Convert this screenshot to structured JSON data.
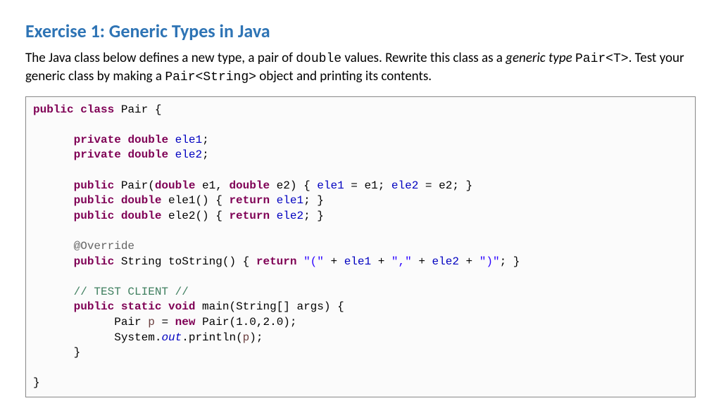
{
  "title": "Exercise 1: Generic Types in Java",
  "description": {
    "part1": "The Java class below defines a new type, a pair of ",
    "code1": "double",
    "part2": " values. Rewrite this class as a ",
    "italic1": "generic type",
    "part3": " ",
    "code2": "Pair<T>",
    "part4": ". Test your generic class by making a ",
    "code3": "Pair<String>",
    "part5": " object and printing its contents."
  },
  "code": {
    "tokens": [
      [
        [
          "kw",
          "public"
        ],
        [
          "plain",
          " "
        ],
        [
          "kw",
          "class"
        ],
        [
          "plain",
          " Pair {"
        ]
      ],
      [],
      [
        [
          "plain",
          "      "
        ],
        [
          "kw",
          "private"
        ],
        [
          "plain",
          " "
        ],
        [
          "kw",
          "double"
        ],
        [
          "plain",
          " "
        ],
        [
          "field",
          "ele1"
        ],
        [
          "plain",
          ";"
        ]
      ],
      [
        [
          "plain",
          "      "
        ],
        [
          "kw",
          "private"
        ],
        [
          "plain",
          " "
        ],
        [
          "kw",
          "double"
        ],
        [
          "plain",
          " "
        ],
        [
          "field",
          "ele2"
        ],
        [
          "plain",
          ";"
        ]
      ],
      [],
      [
        [
          "plain",
          "      "
        ],
        [
          "kw",
          "public"
        ],
        [
          "plain",
          " Pair("
        ],
        [
          "kw",
          "double"
        ],
        [
          "plain",
          " e1, "
        ],
        [
          "kw",
          "double"
        ],
        [
          "plain",
          " e2) { "
        ],
        [
          "field",
          "ele1"
        ],
        [
          "plain",
          " = e1; "
        ],
        [
          "field",
          "ele2"
        ],
        [
          "plain",
          " = e2; }"
        ]
      ],
      [
        [
          "plain",
          "      "
        ],
        [
          "kw",
          "public"
        ],
        [
          "plain",
          " "
        ],
        [
          "kw",
          "double"
        ],
        [
          "plain",
          " ele1() { "
        ],
        [
          "kw",
          "return"
        ],
        [
          "plain",
          " "
        ],
        [
          "field",
          "ele1"
        ],
        [
          "plain",
          "; }"
        ]
      ],
      [
        [
          "plain",
          "      "
        ],
        [
          "kw",
          "public"
        ],
        [
          "plain",
          " "
        ],
        [
          "kw",
          "double"
        ],
        [
          "plain",
          " ele2() { "
        ],
        [
          "kw",
          "return"
        ],
        [
          "plain",
          " "
        ],
        [
          "field",
          "ele2"
        ],
        [
          "plain",
          "; }"
        ]
      ],
      [],
      [
        [
          "plain",
          "      "
        ],
        [
          "annot",
          "@Override"
        ]
      ],
      [
        [
          "plain",
          "      "
        ],
        [
          "kw",
          "public"
        ],
        [
          "plain",
          " String toString() { "
        ],
        [
          "kw",
          "return"
        ],
        [
          "plain",
          " "
        ],
        [
          "str",
          "\"(\""
        ],
        [
          "plain",
          " + "
        ],
        [
          "field",
          "ele1"
        ],
        [
          "plain",
          " + "
        ],
        [
          "str",
          "\",\""
        ],
        [
          "plain",
          " + "
        ],
        [
          "field",
          "ele2"
        ],
        [
          "plain",
          " + "
        ],
        [
          "str",
          "\")\""
        ],
        [
          "plain",
          "; }"
        ]
      ],
      [],
      [
        [
          "plain",
          "      "
        ],
        [
          "comment",
          "// TEST CLIENT //"
        ]
      ],
      [
        [
          "plain",
          "      "
        ],
        [
          "kw",
          "public"
        ],
        [
          "plain",
          " "
        ],
        [
          "kw",
          "static"
        ],
        [
          "plain",
          " "
        ],
        [
          "kw",
          "void"
        ],
        [
          "plain",
          " main(String[] args) {"
        ]
      ],
      [
        [
          "plain",
          "            Pair "
        ],
        [
          "local",
          "p"
        ],
        [
          "plain",
          " = "
        ],
        [
          "kw",
          "new"
        ],
        [
          "plain",
          " Pair(1.0,2.0);"
        ]
      ],
      [
        [
          "plain",
          "            System."
        ],
        [
          "static-field",
          "out"
        ],
        [
          "plain",
          ".println("
        ],
        [
          "local",
          "p"
        ],
        [
          "plain",
          ");"
        ]
      ],
      [
        [
          "plain",
          "      }"
        ]
      ],
      [],
      [
        [
          "plain",
          "}"
        ]
      ]
    ]
  }
}
